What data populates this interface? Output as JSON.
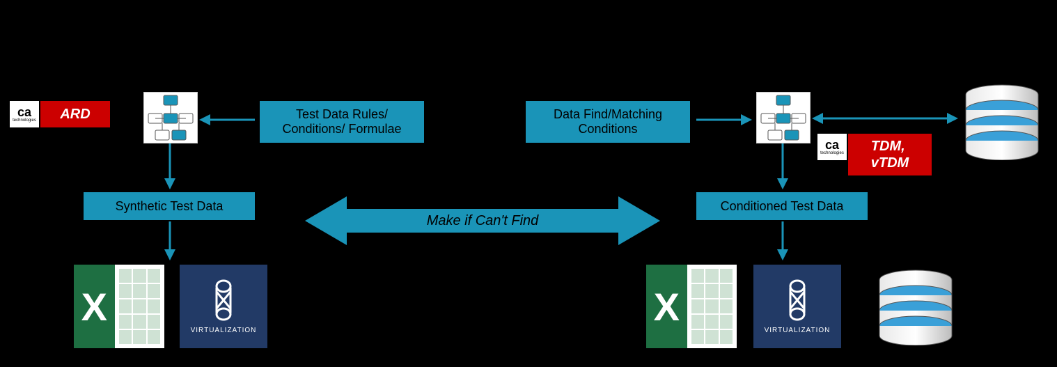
{
  "left": {
    "ca_label": "ca",
    "ca_sub": "technologies",
    "ard_label": "ARD",
    "rules_box": "Test Data Rules/\nConditions/ Formulae",
    "synthetic_box": "Synthetic Test Data",
    "excel_x": "X",
    "virt_label": "VIRTUALIZATION"
  },
  "center": {
    "arrow_text": "Make if Can't Find"
  },
  "right": {
    "match_box": "Data Find/Matching\nConditions",
    "ca_label": "ca",
    "ca_sub": "technologies",
    "tdm_label": "TDM,\nvTDM",
    "conditioned_box": "Conditioned Test Data",
    "excel_x": "X",
    "virt_label": "VIRTUALIZATION"
  },
  "colors": {
    "teal": "#1a94b8",
    "red": "#cc0000",
    "navy": "#223a66",
    "green": "#1e6f42"
  }
}
